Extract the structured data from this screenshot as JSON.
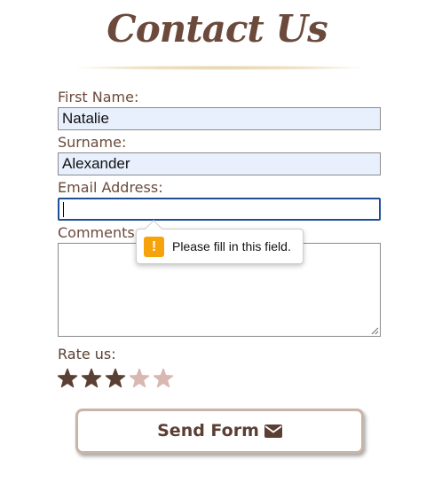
{
  "page": {
    "title": "Contact Us"
  },
  "form": {
    "first_name_label": "First Name:",
    "first_name_value": "Natalie",
    "surname_label": "Surname:",
    "surname_value": "Alexander",
    "email_label": "Email Address:",
    "email_value": "",
    "comments_label": "Comments:",
    "comments_value": ""
  },
  "validation": {
    "message": "Please fill in this field.",
    "icon": "warning-icon"
  },
  "rating": {
    "label": "Rate us:",
    "value": 3,
    "max": 5,
    "icon": "star-icon",
    "filled_color": "#5b3f33",
    "empty_color": "#d8b8b0"
  },
  "submit": {
    "label": "Send Form",
    "icon": "envelope-icon"
  },
  "colors": {
    "text": "#5b3f33",
    "autofill_bg": "#e8f0fe",
    "focus_border": "#1f4e94",
    "warning": "#f6a20a"
  }
}
